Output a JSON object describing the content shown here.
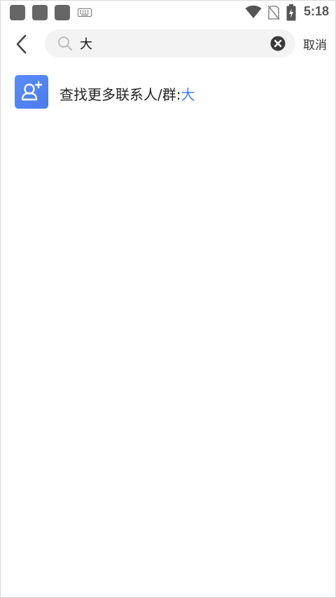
{
  "status_bar": {
    "time": "5:18",
    "icons": [
      "notification-square-icon",
      "notification-square-icon",
      "notification-square-icon",
      "keyboard-icon",
      "wifi-icon",
      "no-sim-icon",
      "battery-charging-icon"
    ]
  },
  "header": {
    "back_icon": "chevron-left-icon",
    "search": {
      "value": "大",
      "icon": "search-icon",
      "clear_icon": "clear-circle-icon"
    },
    "cancel_label": "取消"
  },
  "results": {
    "find_more": {
      "icon": "add-contact-icon",
      "label_prefix": "查找更多联系人/群:",
      "keyword": "大"
    }
  },
  "colors": {
    "accent": "#3b7ef0",
    "icon_bg": "#4f7ff2",
    "search_bg": "#f3f3f3"
  }
}
